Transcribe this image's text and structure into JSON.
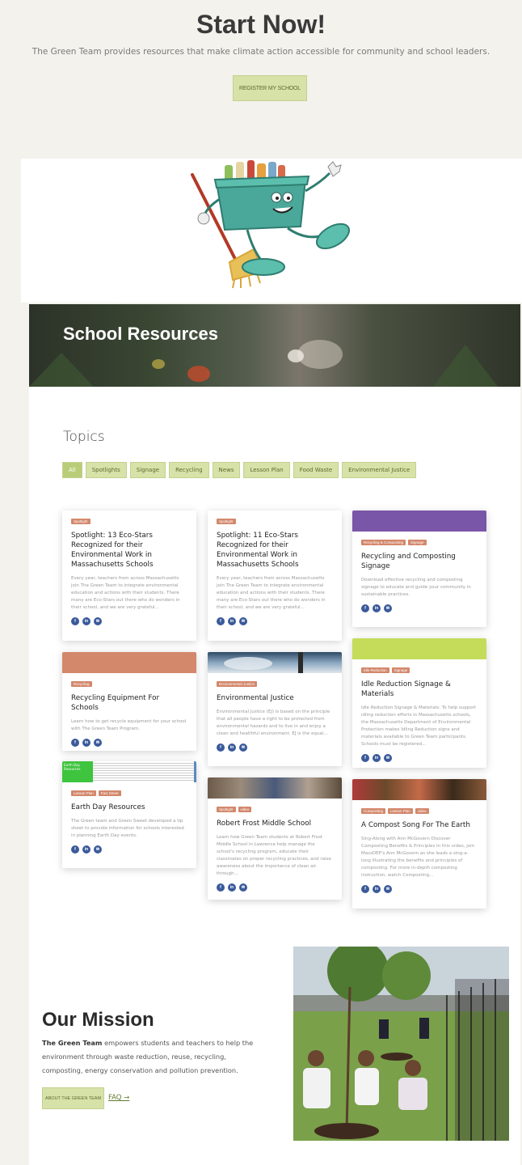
{
  "hero": {
    "title": "Start Now!",
    "subtitle": "The Green Team provides resources that make climate action accessible for community and school leaders.",
    "button": "REGISTER MY SCHOOL"
  },
  "banner": {
    "title": "School Resources"
  },
  "topics": {
    "title": "Topics",
    "filters": [
      "All",
      "Spotlights",
      "Signage",
      "Recycling",
      "News",
      "Lesson Plan",
      "Food Waste",
      "Environmental Justice"
    ]
  },
  "social": {
    "fb": "f",
    "li": "in",
    "mail": "✉"
  },
  "cards": [
    {
      "tags": [
        "Spotlight"
      ],
      "title": "Spotlight: 13 Eco-Stars Recognized for their Environmental Work in Massachusetts Schools",
      "excerpt": "Every year, teachers from across Massachusetts join The Green Team to integrate environmental education and actions with their students. There many are Eco-Stars out there who do wonders in their school, and we are very grateful..."
    },
    {
      "tags": [
        "Spotlight"
      ],
      "title": "Spotlight: 11 Eco-Stars Recognized for their Environmental Work in Massachusetts Schools",
      "excerpt": "Every year, teachers from across Massachusetts join The Green Team to integrate environmental education and actions with their students. There many are Eco-Stars out there who do wonders in their school, and we are very grateful..."
    },
    {
      "tags": [
        "Recycling & Composting",
        "Signage"
      ],
      "title": "Recycling and Composting Signage",
      "excerpt": "Download effective recycling and composting signage to educate and guide your community in sustainable practices."
    },
    {
      "tags": [
        "Recycling"
      ],
      "title": "Recycling Equipment For Schools",
      "excerpt": "Learn how to get recycle equipment for your school with The Green Team Program."
    },
    {
      "tags": [
        "Environmental Justice"
      ],
      "title": "Environmental Justice",
      "excerpt": "Environmental Justice (EJ) is based on the principle that all people have a right to be protected from environmental hazards and to live in and enjoy a clean and healthful environment. EJ is the equal..."
    },
    {
      "tags": [
        "Idle Reduction",
        "Signage"
      ],
      "title": "Idle Reduction Signage & Materials",
      "excerpt": "Idle Reduction Signage & Materials: To help support idling reduction efforts in Massachusetts schools, the Massachusetts Department of Environmental Protection makes Idling Reduction signs and materials available to Green Team participants. Schools must be registered..."
    },
    {
      "tags": [
        "Lesson Plan",
        "Fact Sheet"
      ],
      "title": "Earth Day Resources",
      "excerpt": "The Green team and Green Sweet developed a tip sheet to provide information for schools interested in planning Earth Day events.",
      "thumb_heading": "Earth Day Resources"
    },
    {
      "tags": [
        "Spotlight",
        "video"
      ],
      "title": "Robert Frost Middle School",
      "excerpt": "Learn how Green Team students at Robert Frost Middle School in Lawrence help manage the school's recycling program, educate their classmates on proper recycling practices, and raise awareness about the importance of clean air through..."
    },
    {
      "tags": [
        "Composting",
        "Lesson Plan",
        "video"
      ],
      "title": "A Compost Song For The Earth",
      "excerpt": "Sing-Along with Ann McGovern Discover Composting Benefits & Principles In this video, join MassDEP's Ann McGovern as she leads a sing-a-long illustrating the benefits and principles of composting. For more in-depth composting instruction, watch Composting..."
    }
  ],
  "mission": {
    "title": "Our Mission",
    "org": "The Green Team",
    "text": " empowers students and teachers to help the environment through waste reduction, reuse, recycling, composting, energy conservation and pollution prevention.",
    "button": "ABOUT THE GREEN TEAM",
    "faq": "FAQ →"
  }
}
